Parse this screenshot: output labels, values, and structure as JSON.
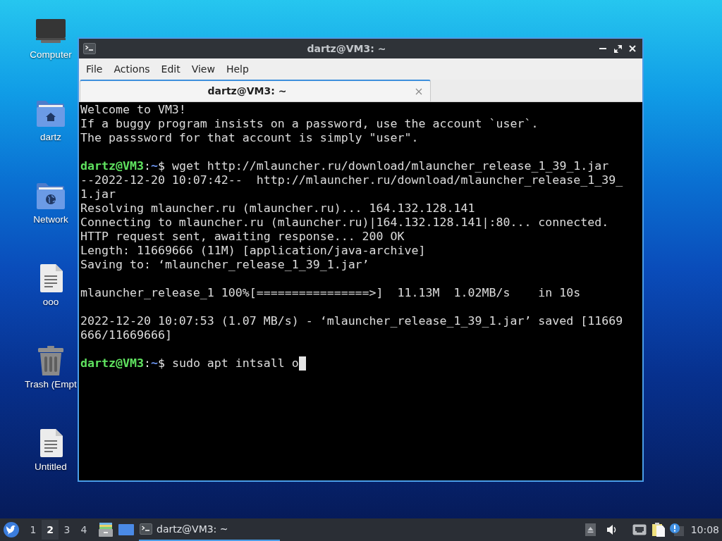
{
  "desktop": {
    "icons": [
      {
        "kind": "computer",
        "label": "Computer"
      },
      {
        "kind": "home-folder",
        "label": "dartz"
      },
      {
        "kind": "network-folder",
        "label": "Network"
      },
      {
        "kind": "document",
        "label": "ooo"
      },
      {
        "kind": "trash",
        "label": "Trash (Empt"
      },
      {
        "kind": "document",
        "label": "Untitled"
      }
    ]
  },
  "window": {
    "title": "dartz@VM3: ~",
    "menu": [
      "File",
      "Actions",
      "Edit",
      "View",
      "Help"
    ],
    "tabs": [
      {
        "label": "dartz@VM3: ~",
        "selected": true
      }
    ],
    "terminal": {
      "lines": [
        {
          "kind": "output",
          "text": "Welcome to VM3!"
        },
        {
          "kind": "output",
          "text": "If a buggy program insists on a password, use the account `user`."
        },
        {
          "kind": "output",
          "text": "The passsword for that account is simply \"user\"."
        },
        {
          "kind": "blank"
        },
        {
          "kind": "prompt",
          "user": "dartz@VM3",
          "separator": ":",
          "path": "~",
          "symbol": "$",
          "command": "wget http://mlauncher.ru/download/mlauncher_release_1_39_1.jar",
          "cursor": false
        },
        {
          "kind": "output",
          "text": "--2022-12-20 10:07:42--  http://mlauncher.ru/download/mlauncher_release_1_39_"
        },
        {
          "kind": "output",
          "text": "1.jar"
        },
        {
          "kind": "output",
          "text": "Resolving mlauncher.ru (mlauncher.ru)... 164.132.128.141"
        },
        {
          "kind": "output",
          "text": "Connecting to mlauncher.ru (mlauncher.ru)|164.132.128.141|:80... connected."
        },
        {
          "kind": "output",
          "text": "HTTP request sent, awaiting response... 200 OK"
        },
        {
          "kind": "output",
          "text": "Length: 11669666 (11M) [application/java-archive]"
        },
        {
          "kind": "output",
          "text": "Saving to: ‘mlauncher_release_1_39_1.jar’"
        },
        {
          "kind": "blank"
        },
        {
          "kind": "output",
          "text": "mlauncher_release_1 100%[================>]  11.13M  1.02MB/s    in 10s"
        },
        {
          "kind": "blank"
        },
        {
          "kind": "output",
          "text": "2022-12-20 10:07:53 (1.07 MB/s) - ‘mlauncher_release_1_39_1.jar’ saved [11669"
        },
        {
          "kind": "output",
          "text": "666/11669666]"
        },
        {
          "kind": "blank"
        },
        {
          "kind": "prompt",
          "user": "dartz@VM3",
          "separator": ":",
          "path": "~",
          "symbol": "$",
          "command": "sudo apt intsall o",
          "cursor": true
        }
      ]
    }
  },
  "taskbar": {
    "workspaces": [
      {
        "label": "1",
        "selected": false
      },
      {
        "label": "2",
        "selected": true
      },
      {
        "label": "3",
        "selected": false
      },
      {
        "label": "4",
        "selected": false
      }
    ],
    "tasks": [
      {
        "label": "dartz@VM3: ~",
        "selected": true
      }
    ],
    "clock": "10:08"
  }
}
